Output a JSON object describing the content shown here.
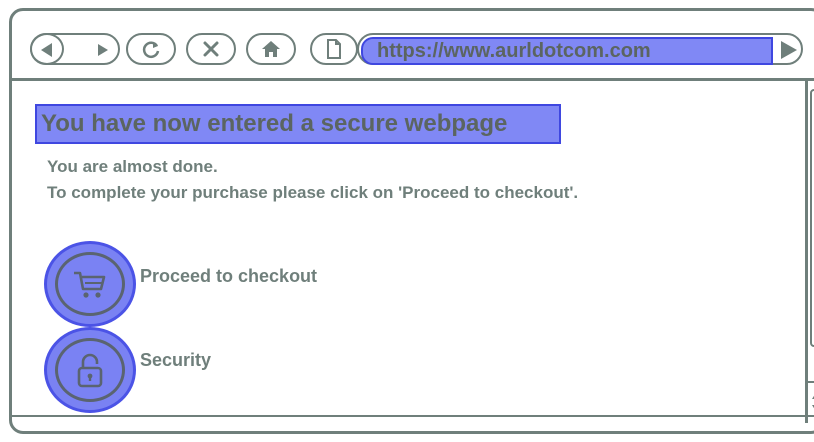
{
  "browser": {
    "url": "https://www.aurldotcom.com"
  },
  "page": {
    "heading": "You have now entered a secure webpage",
    "message_line1": "You are almost done.",
    "message_line2": "To complete your purchase please click on 'Proceed to checkout'."
  },
  "actions": [
    {
      "label": "Proceed to checkout",
      "icon": "cart-icon"
    },
    {
      "label": "Security",
      "icon": "lock-icon"
    }
  ],
  "colors": {
    "frame": "#6f7f7b",
    "highlight_fill": "#8088f5",
    "highlight_border": "#3f47e0"
  }
}
